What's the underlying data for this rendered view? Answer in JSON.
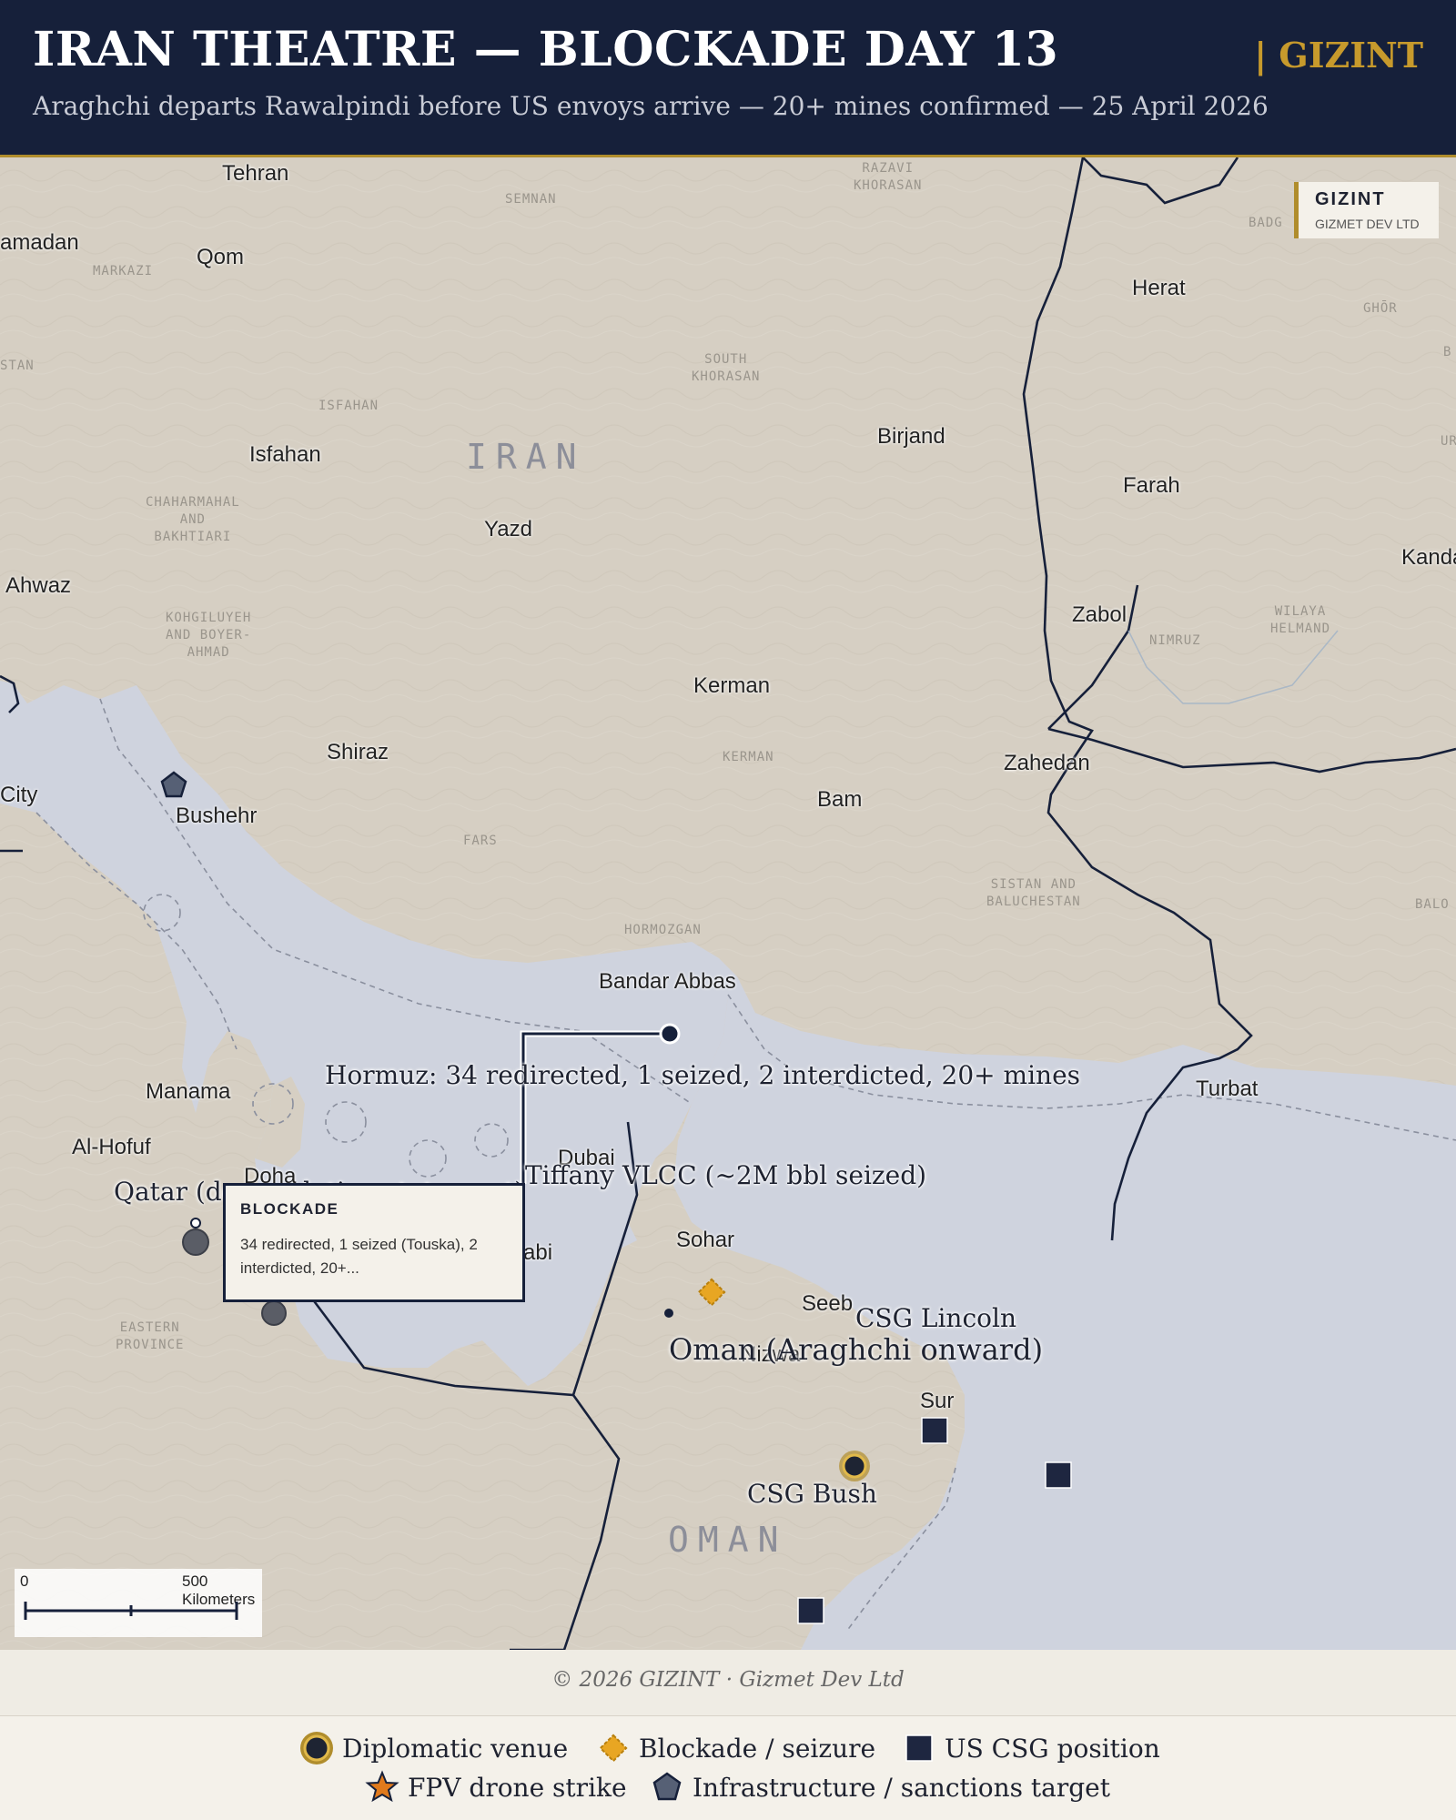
{
  "header": {
    "title": "IRAN THEATRE — BLOCKADE DAY 13",
    "subtitle": "Araghchi departs Rawalpindi before US envoys arrive — 20+ mines confirmed — 25 April 2026",
    "brand": "| GIZINT"
  },
  "map": {
    "brand_box": {
      "name": "GIZINT",
      "sub": "GIZMET DEV LTD"
    },
    "countries": [
      "IRAN",
      "OMAN"
    ],
    "cities": [
      "Tehran",
      "amadan",
      "Qom",
      "Herat",
      "Isfahan",
      "Birjand",
      "Farah",
      "Yazd",
      "Ahwaz",
      "Kanda",
      "Zabol",
      "Kerman",
      "Shiraz",
      "Zahedan",
      "City",
      "Bushehr",
      "Bam",
      "Bandar Abbas",
      "Turbat",
      "Manama",
      "Al-Hofuf",
      "Doha",
      "Dubai",
      "Abu Dhabi",
      "Sohar",
      "Seeb",
      "Nizwa",
      "Sur"
    ],
    "regions": [
      "RAZAVI\nKHORASAN",
      "SEMNAN",
      "MARKAZI",
      "BADG",
      "GHŌR",
      "STAN",
      "SOUTH\nKHORASAN",
      "ISFAHAN",
      "UR",
      "CHAHARMAHAL\nAND\nBAKHTIARI",
      "KOHGILUYEH\nAND BOYER-\nAHMAD",
      "NIMRUZ",
      "WILAYA\nHELMAND",
      "KERMAN",
      "FARS",
      "SISTAN AND\nBALUCHESTAN",
      "BALO",
      "HORMOZGAN",
      "EASTERN\nPROVINCE",
      "B"
    ],
    "annotations": {
      "hormuz": "Hormuz: 34 redirected, 1 seized, 2 interdicted, 20+ mines",
      "tiffany": "Tiffany VLCC (~2M bbl seized)",
      "qatar": "Qatar (de-escalation statement)",
      "lincoln": "CSG Lincoln",
      "oman": "Oman (Araghchi onward)",
      "bush": "CSG Bush"
    },
    "popup": {
      "title": "BLOCKADE",
      "text": "34 redirected, 1 seized (Touska), 2 interdicted, 20+..."
    },
    "scale": {
      "zero": "0",
      "label": "500 Kilometers"
    }
  },
  "footer": {
    "copyright": "© 2026 GIZINT · Gizmet Dev Ltd"
  },
  "legend": {
    "items": [
      {
        "label": "Diplomatic venue",
        "icon": "diplomatic-venue-icon"
      },
      {
        "label": "Blockade / seizure",
        "icon": "blockade-diamond-icon"
      },
      {
        "label": "US CSG position",
        "icon": "csg-square-icon"
      },
      {
        "label": "FPV drone strike",
        "icon": "drone-star-icon"
      },
      {
        "label": "Infrastructure / sanctions target",
        "icon": "infrastructure-pentagon-icon"
      }
    ]
  },
  "colors": {
    "navy": "#16203a",
    "gold": "#b08d2c",
    "sea": "#cfd3de",
    "land": "#d6cfc3"
  }
}
